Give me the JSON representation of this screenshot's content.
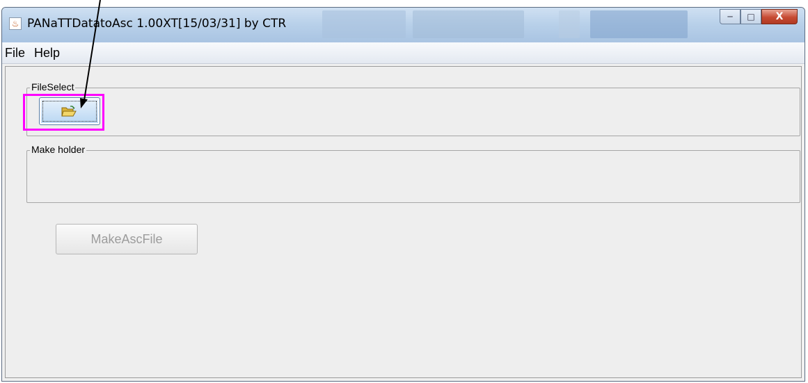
{
  "window": {
    "title": "PANaTTDatatoAsc 1.00XT[15/03/31] by CTR",
    "app_icon": "java-icon",
    "controls": {
      "minimize_icon": "minimize-icon",
      "maximize_icon": "maximize-icon",
      "close_icon": "close-icon",
      "minimize_glyph": "─",
      "maximize_glyph": "□",
      "close_glyph": "X"
    }
  },
  "menubar": {
    "items": [
      {
        "label": "File"
      },
      {
        "label": "Help"
      }
    ]
  },
  "file_select": {
    "title": "FileSelect",
    "button_icon": "folder-open-icon",
    "highlight_color": "#ff00ff"
  },
  "make_holder": {
    "title": "Make holder",
    "value": ""
  },
  "make_asc_button": {
    "label": "MakeAscFile",
    "state": "disabled"
  },
  "annotation": {
    "arrow_color": "#000000"
  }
}
